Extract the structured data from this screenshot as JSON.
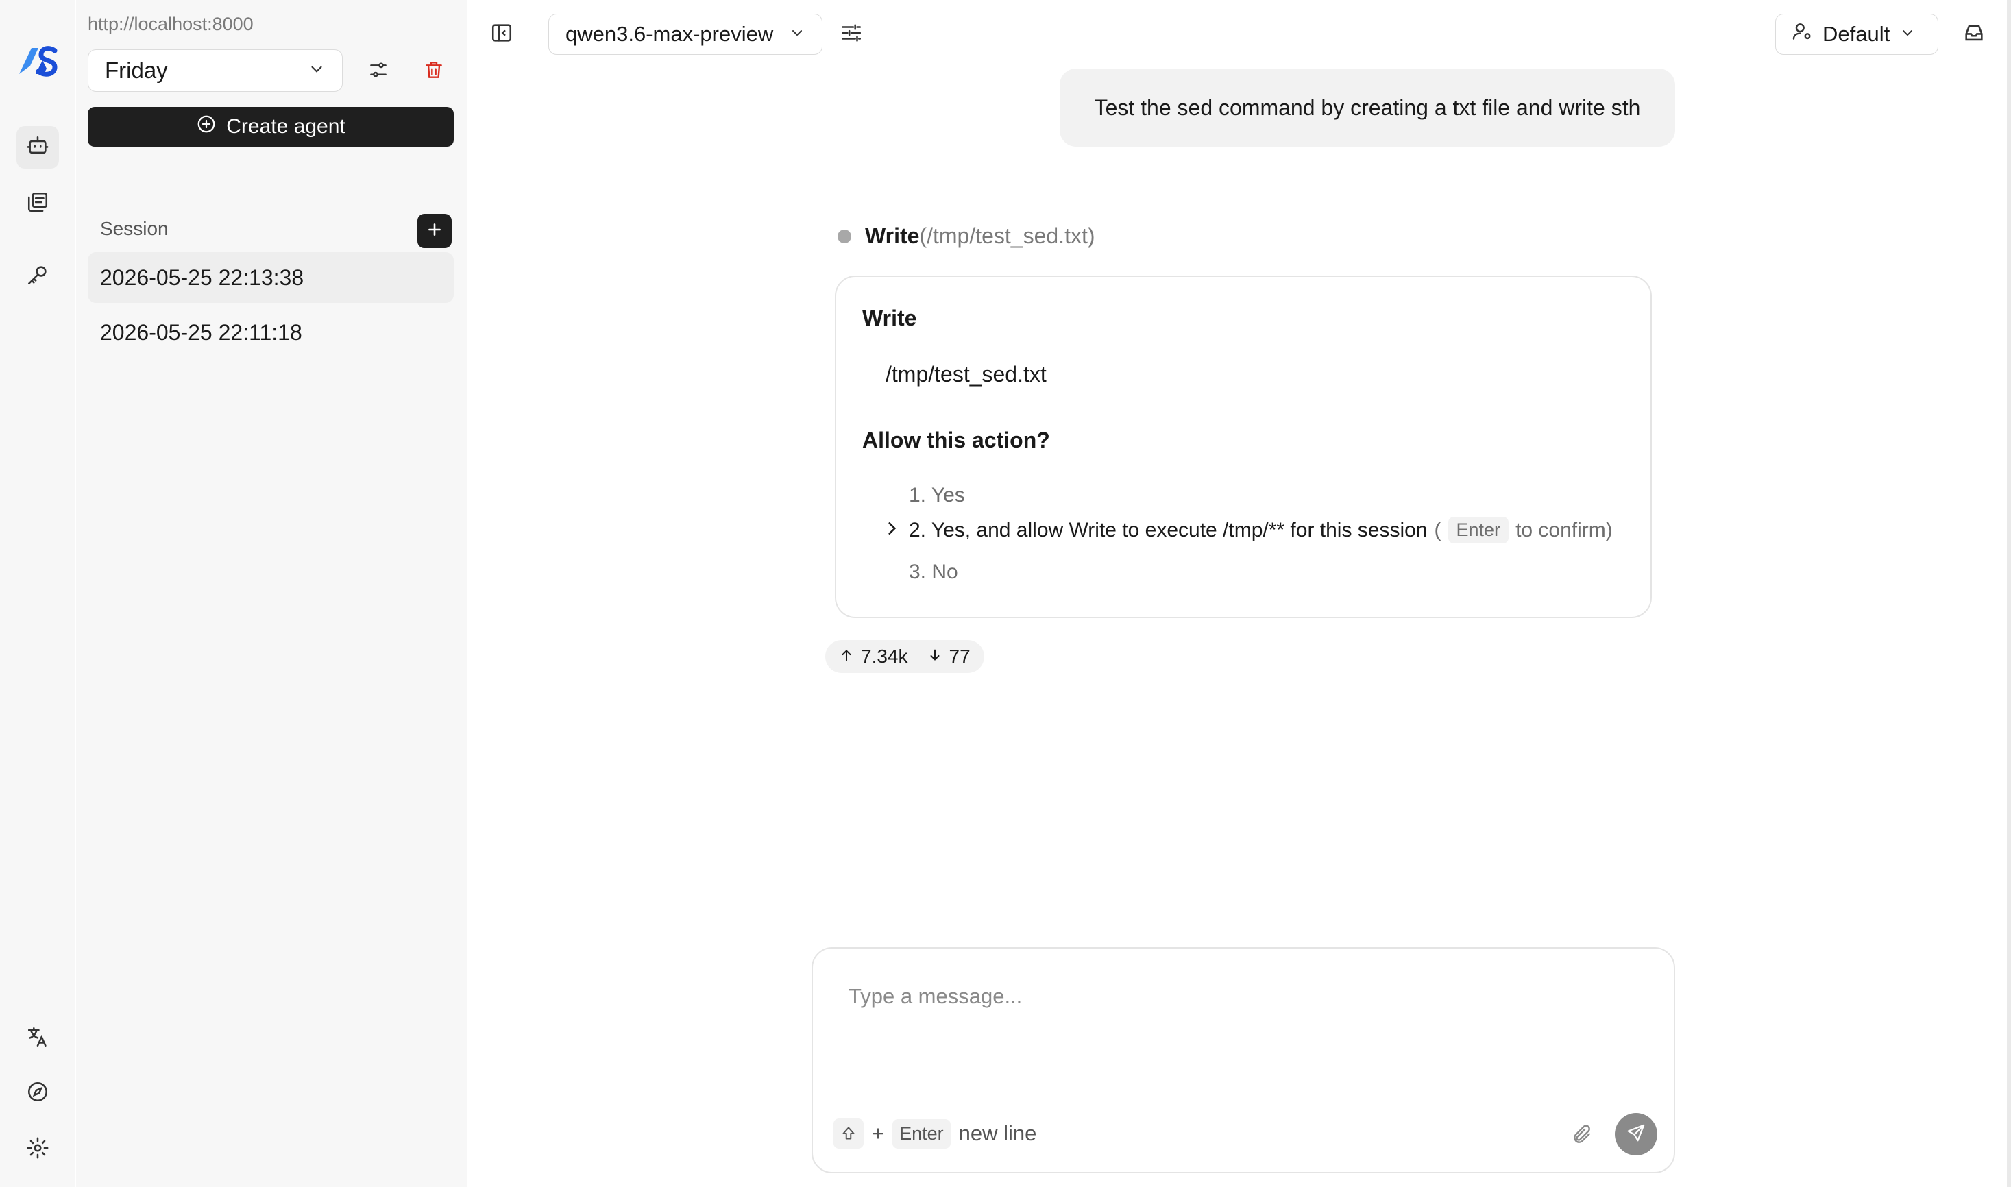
{
  "sidebar": {
    "host": "http://localhost:8000",
    "agent_selected": "Friday",
    "create_agent_label": "Create agent",
    "session_label": "Session",
    "sessions": [
      {
        "label": "2026-05-25 22:13:38"
      },
      {
        "label": "2026-05-25 22:11:18"
      }
    ]
  },
  "rail": {
    "icons": [
      "agent-icon",
      "projects-icon",
      "key-icon",
      "translate-icon",
      "compass-icon",
      "settings-icon"
    ]
  },
  "topbar": {
    "model": "qwen3.6-max-preview",
    "profile": "Default"
  },
  "chat": {
    "user_message": "Test the sed command by creating a txt file and write sth",
    "tool": {
      "name": "Write",
      "path_paren": "(/tmp/test_sed.txt)",
      "card_title": "Write",
      "card_path": "/tmp/test_sed.txt",
      "question": "Allow this action?",
      "options": [
        {
          "label": "1. Yes"
        },
        {
          "label": "2. Yes, and allow Write to execute /tmp/** for this session"
        },
        {
          "label": "3. No"
        }
      ],
      "hint_open": "(",
      "hint_key": "Enter",
      "hint_close": "to confirm)"
    },
    "usage": {
      "input": "7.34k",
      "output": "77"
    }
  },
  "composer": {
    "placeholder": "Type a message...",
    "plus": "+",
    "enter_key": "Enter",
    "newline_label": "new line"
  },
  "colors": {
    "dark": "#1f1f1f",
    "danger": "#d92d20",
    "muted": "#7a7a7a",
    "logo_light": "#3b8cf0",
    "logo_dark": "#1b4fd8"
  }
}
